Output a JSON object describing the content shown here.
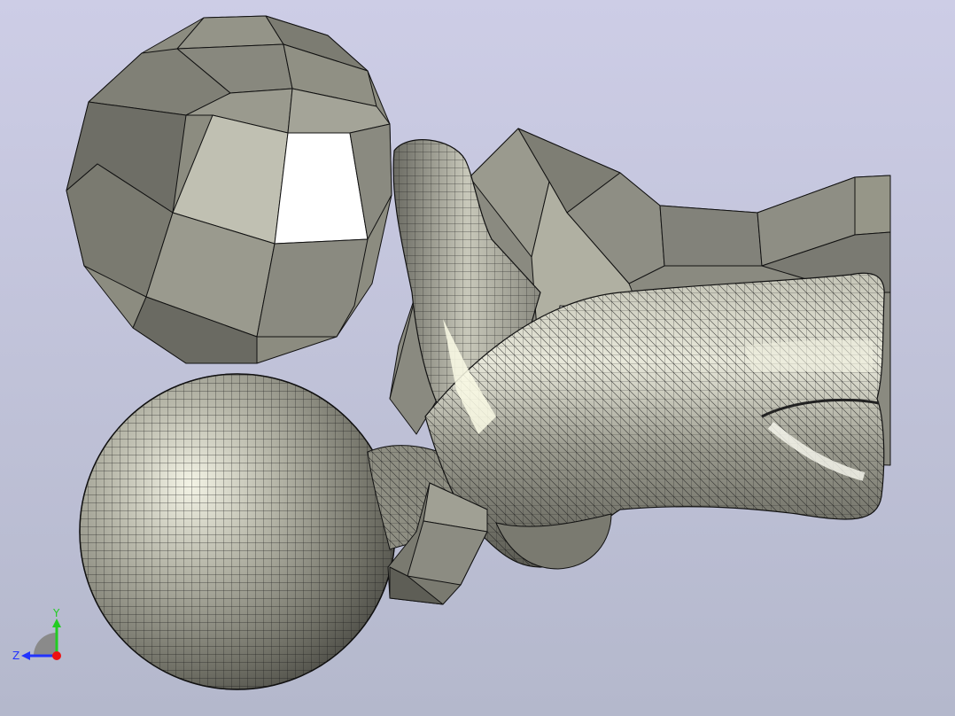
{
  "viewport": {
    "background_top": "#cdcde6",
    "background_bottom": "#b4b8cc"
  },
  "scene": {
    "objects": [
      {
        "name": "coarse-sphere",
        "mesh": "coarse-polygonal",
        "color": "#8c8c80"
      },
      {
        "name": "smooth-sphere",
        "mesh": "fine-quad",
        "color": "#a8a89a"
      },
      {
        "name": "torso-branch",
        "mesh": "fine-mixed",
        "color": "#a6a698"
      },
      {
        "name": "coarse-slab",
        "mesh": "coarse-polygonal",
        "color": "#8a8a80"
      }
    ],
    "highlight_color": "#ffffff",
    "edge_color": "#111111"
  },
  "triad": {
    "y_label": "Y",
    "z_label": "Z",
    "y_color": "#22cc22",
    "z_color": "#2233ff",
    "x_color": "#ee1111"
  }
}
